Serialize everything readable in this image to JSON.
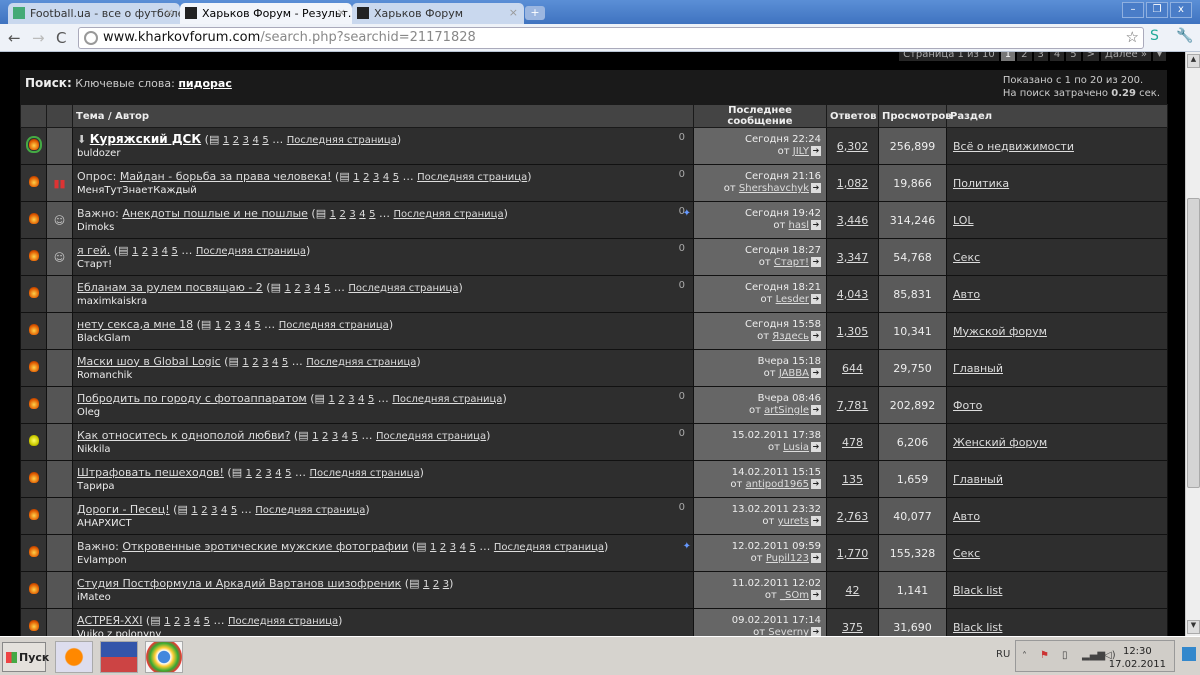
{
  "browser": {
    "tabs": [
      {
        "label": "Football.ua - все о футболе",
        "active": false
      },
      {
        "label": "Харьков Форум - Результ…",
        "active": true
      },
      {
        "label": "Харьков Форум",
        "active": false
      }
    ],
    "url_host": "www.kharkovforum.com",
    "url_path": "/search.php?searchid=21171828"
  },
  "pager": {
    "label": "Страница 1 из 10",
    "pages": [
      "1",
      "2",
      "3",
      "4",
      "5"
    ],
    "next": ">",
    "further": "Далее »"
  },
  "search": {
    "title": "Поиск:",
    "keywords_label": "Ключевые слова:",
    "keyword": "пидорас",
    "shown": "Показано с 1 по 20 из 200.",
    "time_prefix": "На поиск затрачено",
    "time": "0.29",
    "time_suffix": "сек."
  },
  "columns": {
    "topic": "Тема / Автор",
    "last": "Последнее сообщение",
    "replies": "Ответов",
    "views": "Просмотров",
    "section": "Раздел"
  },
  "last_page_label": "Последняя страница",
  "by": "от",
  "rows": [
    {
      "prefix": "",
      "title": "Куряжский ДСК",
      "bold": true,
      "pages": [
        "1",
        "2",
        "3",
        "4",
        "5"
      ],
      "more": true,
      "author": "buldozer",
      "status": "green",
      "icon": "",
      "clip": true,
      "pin": false,
      "date": "Сегодня 22:24",
      "user": "JILY",
      "replies": "6,302",
      "views": "256,899",
      "section": "Всё о недвижимости"
    },
    {
      "prefix": "Опрос:",
      "title": "Майдан - борьба за права человека!",
      "pages": [
        "1",
        "2",
        "3",
        "4",
        "5"
      ],
      "more": true,
      "author": "МеняТутЗнаетКаждый",
      "status": "normal",
      "icon": "poll",
      "clip": true,
      "pin": false,
      "date": "Сегодня 21:16",
      "user": "Shershavchyk",
      "replies": "1,082",
      "views": "19,866",
      "section": "Политика"
    },
    {
      "prefix": "Важно:",
      "title": "Анекдоты пошлые и не пошлые",
      "pages": [
        "1",
        "2",
        "3",
        "4",
        "5"
      ],
      "more": true,
      "author": "Dimoks",
      "status": "normal",
      "icon": "face",
      "clip": true,
      "pin": true,
      "date": "Сегодня 19:42",
      "user": "hasl",
      "replies": "3,446",
      "views": "314,246",
      "section": "LOL"
    },
    {
      "prefix": "",
      "title": "я гей.",
      "pages": [
        "1",
        "2",
        "3",
        "4",
        "5"
      ],
      "more": true,
      "author": "Старт!",
      "status": "normal",
      "icon": "face",
      "clip": true,
      "pin": false,
      "date": "Сегодня 18:27",
      "user": "Старт!",
      "replies": "3,347",
      "views": "54,768",
      "section": "Секс"
    },
    {
      "prefix": "",
      "title": "Ебланам за рулем посвящаю - 2",
      "pages": [
        "1",
        "2",
        "3",
        "4",
        "5"
      ],
      "more": true,
      "author": "maximkaiskra",
      "status": "normal",
      "icon": "",
      "clip": true,
      "pin": false,
      "date": "Сегодня 18:21",
      "user": "Lesder",
      "replies": "4,043",
      "views": "85,831",
      "section": "Авто"
    },
    {
      "prefix": "",
      "title": "нету секса,а мне 18",
      "pages": [
        "1",
        "2",
        "3",
        "4",
        "5"
      ],
      "more": true,
      "author": "BlackGlam",
      "status": "normal",
      "icon": "",
      "clip": false,
      "pin": false,
      "date": "Сегодня 15:58",
      "user": "Яздесь",
      "replies": "1,305",
      "views": "10,341",
      "section": "Мужской форум"
    },
    {
      "prefix": "",
      "title": "Маски шоу в Global Logic",
      "pages": [
        "1",
        "2",
        "3",
        "4",
        "5"
      ],
      "more": true,
      "author": "Romanchik",
      "status": "normal",
      "icon": "",
      "clip": false,
      "pin": false,
      "date": "Вчера 15:18",
      "user": "JABBA",
      "replies": "644",
      "views": "29,750",
      "section": "Главный"
    },
    {
      "prefix": "",
      "title": "Побродить по городу с фотоаппаратом",
      "pages": [
        "1",
        "2",
        "3",
        "4",
        "5"
      ],
      "more": true,
      "author": "Oleg",
      "status": "normal",
      "icon": "",
      "clip": true,
      "pin": false,
      "date": "Вчера 08:46",
      "user": "artSingle",
      "replies": "7,781",
      "views": "202,892",
      "section": "Фото"
    },
    {
      "prefix": "",
      "title": "Как относитесь к однополой любви?",
      "pages": [
        "1",
        "2",
        "3",
        "4",
        "5"
      ],
      "more": true,
      "author": "Nikkila",
      "status": "hot",
      "icon": "",
      "clip": true,
      "pin": false,
      "date": "15.02.2011 17:38",
      "user": "Lusia",
      "replies": "478",
      "views": "6,206",
      "section": "Женский форум"
    },
    {
      "prefix": "",
      "title": "Штрафовать пешеходов!",
      "pages": [
        "1",
        "2",
        "3",
        "4",
        "5"
      ],
      "more": true,
      "author": "Тарира",
      "status": "normal",
      "icon": "",
      "clip": false,
      "pin": false,
      "date": "14.02.2011 15:15",
      "user": "antipod1965",
      "replies": "135",
      "views": "1,659",
      "section": "Главный"
    },
    {
      "prefix": "",
      "title": "Дороги - Песец!",
      "pages": [
        "1",
        "2",
        "3",
        "4",
        "5"
      ],
      "more": true,
      "author": "АНАРХИСТ",
      "status": "normal",
      "icon": "",
      "clip": true,
      "pin": false,
      "date": "13.02.2011 23:32",
      "user": "yurets",
      "replies": "2,763",
      "views": "40,077",
      "section": "Авто"
    },
    {
      "prefix": "Важно:",
      "title": "Откровенные эротические мужские фотографии",
      "pages": [
        "1",
        "2",
        "3",
        "4",
        "5"
      ],
      "more": true,
      "author": "Evlampon",
      "status": "normal",
      "icon": "",
      "clip": false,
      "pin": true,
      "date": "12.02.2011 09:59",
      "user": "Pupil123",
      "replies": "1,770",
      "views": "155,328",
      "section": "Секс"
    },
    {
      "prefix": "",
      "title": "Студия Постформула и Аркадий Вартанов шизофреник",
      "pages": [
        "1",
        "2",
        "3"
      ],
      "more": false,
      "author": "iMateo",
      "status": "normal",
      "icon": "",
      "clip": false,
      "pin": false,
      "date": "11.02.2011 12:02",
      "user": "_SOm",
      "replies": "42",
      "views": "1,141",
      "section": "Black list"
    },
    {
      "prefix": "",
      "title": "АСТРЕЯ-XXI",
      "pages": [
        "1",
        "2",
        "3",
        "4",
        "5"
      ],
      "more": true,
      "author": "Vuiko z polonyny",
      "status": "normal",
      "icon": "",
      "clip": false,
      "pin": false,
      "date": "09.02.2011 17:14",
      "user": "Severny",
      "replies": "375",
      "views": "31,690",
      "section": "Black list"
    }
  ],
  "taskbar": {
    "start": "Пуск",
    "lang": "RU",
    "time": "12:30",
    "date": "17.02.2011"
  }
}
